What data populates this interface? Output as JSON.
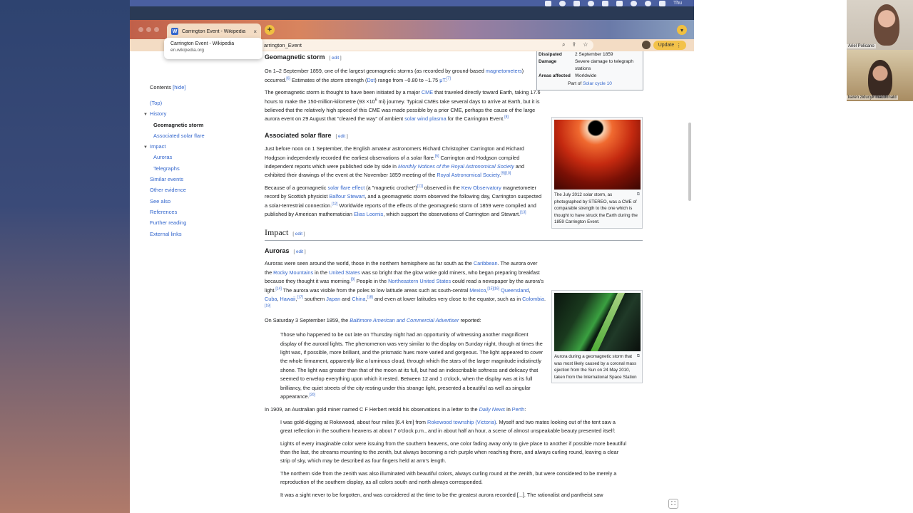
{
  "menubar": {
    "clock": "Thu"
  },
  "video_call": {
    "participants": [
      {
        "name": "Ariel Policano"
      },
      {
        "name": "karen ziducyk macdonald"
      }
    ]
  },
  "browser": {
    "tab": {
      "favicon": "W",
      "title": "Carrington Event - Wikipedia",
      "close": "×"
    },
    "newtab": "+",
    "address": "arrington_Event",
    "update_label": "Update",
    "tooltip": {
      "title": "Carrington Event - Wikipedia",
      "domain": "en.wikipedia.org"
    }
  },
  "toc": {
    "label": "Contents",
    "hide": "[hide]",
    "items": [
      {
        "label": "(Top)"
      },
      {
        "label": "History"
      },
      {
        "label": "Geomagnetic storm"
      },
      {
        "label": "Associated solar flare"
      },
      {
        "label": "Impact"
      },
      {
        "label": "Auroras"
      },
      {
        "label": "Telegraphs"
      },
      {
        "label": "Similar events"
      },
      {
        "label": "Other evidence"
      },
      {
        "label": "See also"
      },
      {
        "label": "References"
      },
      {
        "label": "Further reading"
      },
      {
        "label": "External links"
      }
    ]
  },
  "infobox": {
    "rows": [
      {
        "k": "Dissipated",
        "v": "2 September 1859"
      },
      {
        "k": "Damage",
        "v": "Severe damage to telegraph stations"
      },
      {
        "k": "Areas affected",
        "v": "Worldwide"
      }
    ],
    "footer_prefix": "Part of ",
    "footer_link": "Solar cycle 10"
  },
  "images": {
    "solar": {
      "caption": "The July 2012 solar storm, as photographed by STEREO, was a CME of comparable strength to the one which is thought to have struck the Earth during the 1859 Carrington Event."
    },
    "aurora": {
      "caption": "Aurora during a geomagnetic storm that was most likely caused by a coronal mass ejection from the Sun on 24 May 2010, taken from the International Space Station"
    }
  },
  "article": {
    "edit": "edit",
    "s_geomag": "Geomagnetic storm",
    "s_flare": "Associated solar flare",
    "s_impact": "Impact",
    "s_auroras": "Auroras"
  }
}
